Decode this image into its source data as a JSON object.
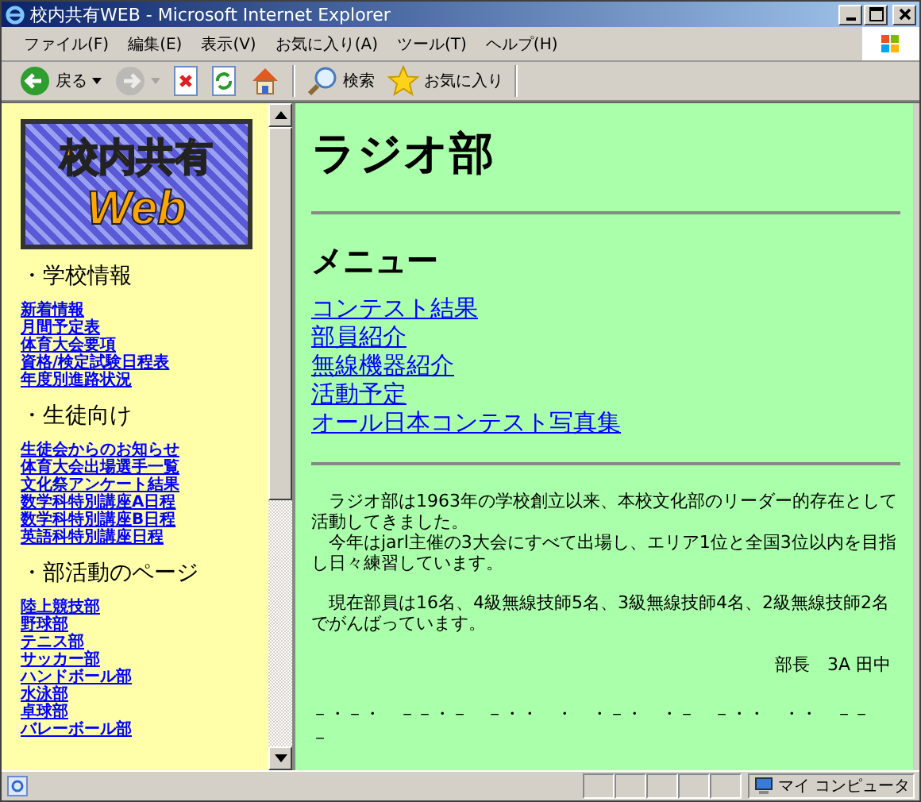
{
  "window": {
    "title": "校内共有WEB - Microsoft Internet Explorer"
  },
  "menu": [
    "ファイル(F)",
    "編集(E)",
    "表示(V)",
    "お気に入り(A)",
    "ツール(T)",
    "ヘルプ(H)"
  ],
  "toolbar": [
    {
      "kind": "back",
      "label": "戻る",
      "dropdown": true,
      "disabled": false
    },
    {
      "kind": "forward",
      "dropdown": true,
      "disabled": true
    },
    {
      "kind": "stop",
      "disabled": false
    },
    {
      "kind": "refresh",
      "disabled": false
    },
    {
      "kind": "home",
      "disabled": false
    },
    {
      "kind": "search",
      "label": "検索",
      "disabled": false
    },
    {
      "kind": "favorites",
      "label": "お気に入り",
      "disabled": false
    }
  ],
  "sidebar": {
    "logo": {
      "line1": "校内共有",
      "line2": "Web"
    },
    "sections": [
      {
        "heading": "・学校情報",
        "links": [
          "新着情報",
          "月間予定表",
          "体育大会要項",
          "資格/検定試験日程表",
          "年度別進路状況"
        ]
      },
      {
        "heading": "・生徒向け",
        "links": [
          "生徒会からのお知らせ",
          "体育大会出場選手一覧",
          "文化祭アンケート結果",
          "数学科特別講座A日程",
          "数学科特別講座B日程",
          "英語科特別講座日程"
        ]
      },
      {
        "heading": "・部活動のページ",
        "links": [
          "陸上競技部",
          "野球部",
          "テニス部",
          "サッカー部",
          "ハンドボール部",
          "水泳部",
          "卓球部",
          "バレーボール部"
        ]
      }
    ]
  },
  "main": {
    "title": "ラジオ部",
    "menu_heading": "メニュー",
    "links": [
      "コンテスト結果",
      "部員紹介",
      "無線機器紹介",
      "活動予定",
      "オール日本コンテスト写真集"
    ],
    "paragraphs": [
      [
        "ラジオ部は1963年の学校創立以来、本校文化部のリーダー的存在として活動してきました。",
        "今年はjarl主催の3大会にすべて出場し、エリア1位と全国3位以内を目指し日々練習しています。"
      ],
      [
        "現在部員は16名、4級無線技師5名、3級無線技師4名、2級無線技師2名でがんばっています。"
      ]
    ],
    "signature": "部長　3A 田中",
    "morse": [
      "－・－・　－－・－　－・・　・　・－・　・－　－・・　・・　－－",
      "－"
    ]
  },
  "status_bar": {
    "zone": "マイ コンピュータ"
  }
}
